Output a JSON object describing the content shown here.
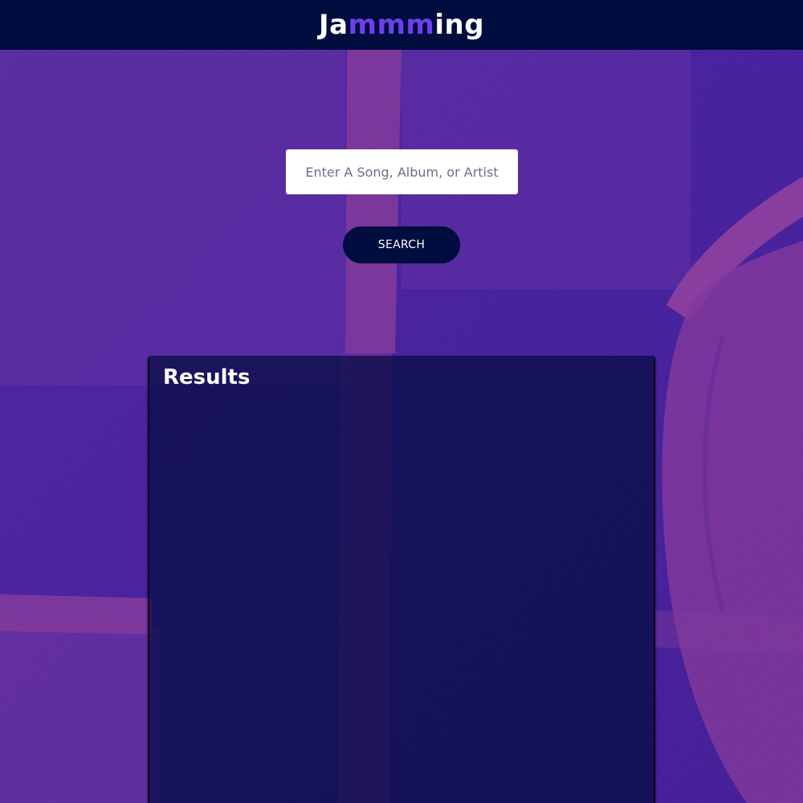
{
  "app": {
    "logo_prefix": "Ja",
    "logo_accent": "mmm",
    "logo_suffix": "ing",
    "accent_color": "#6c41ec",
    "header_color": "#010c3f"
  },
  "search": {
    "placeholder": "Enter A Song, Album, or Artist",
    "value": "",
    "button_label": "SEARCH"
  },
  "results": {
    "title": "Results",
    "items": []
  },
  "background": {
    "description_icon": "headphones-photo-icon",
    "tint_color": "#3a1a99"
  }
}
